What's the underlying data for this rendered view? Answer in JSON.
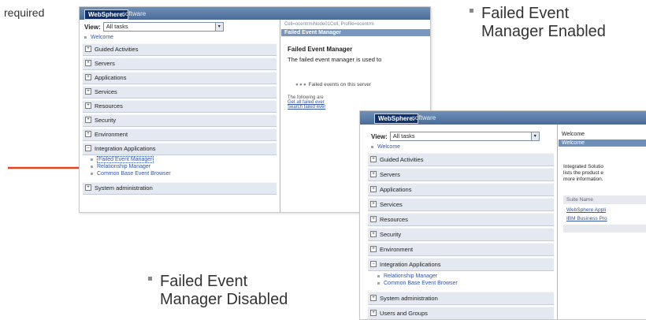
{
  "slide": {
    "top_left_text": "required",
    "callout_enabled": [
      "Failed Event",
      "Manager Enabled"
    ],
    "callout_disabled": [
      "Failed Event",
      "Manager Disabled"
    ]
  },
  "colors": {
    "arrow": "#e8401c",
    "brand_bar": "#4a6c98",
    "nav_bg": "#e3e8f1"
  },
  "shot_enabled": {
    "brand": "WebSphere.",
    "brand_soft": "software",
    "view_label": "View:",
    "view_value": "All tasks",
    "welcome": "Welcome",
    "nav": [
      "Guided Activities",
      "Servers",
      "Applications",
      "Services",
      "Resources",
      "Security",
      "Environment",
      "Integration Applications"
    ],
    "sub_items": [
      "Failed Event Manager",
      "Relationship Manager",
      "Common Base Event Browser"
    ],
    "nav_bottom": "System administration",
    "path": "Cell=ocentrmiNode01Cell, Profile=ocentrm",
    "panel_title": "Failed Event Manager",
    "heading": "Failed Event Manager",
    "desc": "The failed event manager is used to",
    "status": "Failed events on this server",
    "following": "The following are",
    "link1": "Get all failed ever",
    "link2": "Search failed ever"
  },
  "shot_disabled": {
    "brand": "WebSphere.",
    "brand_soft": "software",
    "view_label": "View:",
    "view_value": "All tasks",
    "welcome": "Welcome",
    "nav": [
      "Guided Activities",
      "Servers",
      "Applications",
      "Services",
      "Resources",
      "Security",
      "Environment",
      "Integration Applications"
    ],
    "sub_items": [
      "Relationship Manager",
      "Common Base Event Browser"
    ],
    "nav_bottom": [
      "System administration",
      "Users and Groups"
    ],
    "right_top": "Welcome",
    "right_bar": "Welcome",
    "intro": [
      "Integrated Solutio",
      "lists the product e",
      "more information."
    ],
    "suite_header": "Suite Name",
    "suite_rows": [
      "WebSphere Appli",
      "IBM Business Pro"
    ]
  }
}
